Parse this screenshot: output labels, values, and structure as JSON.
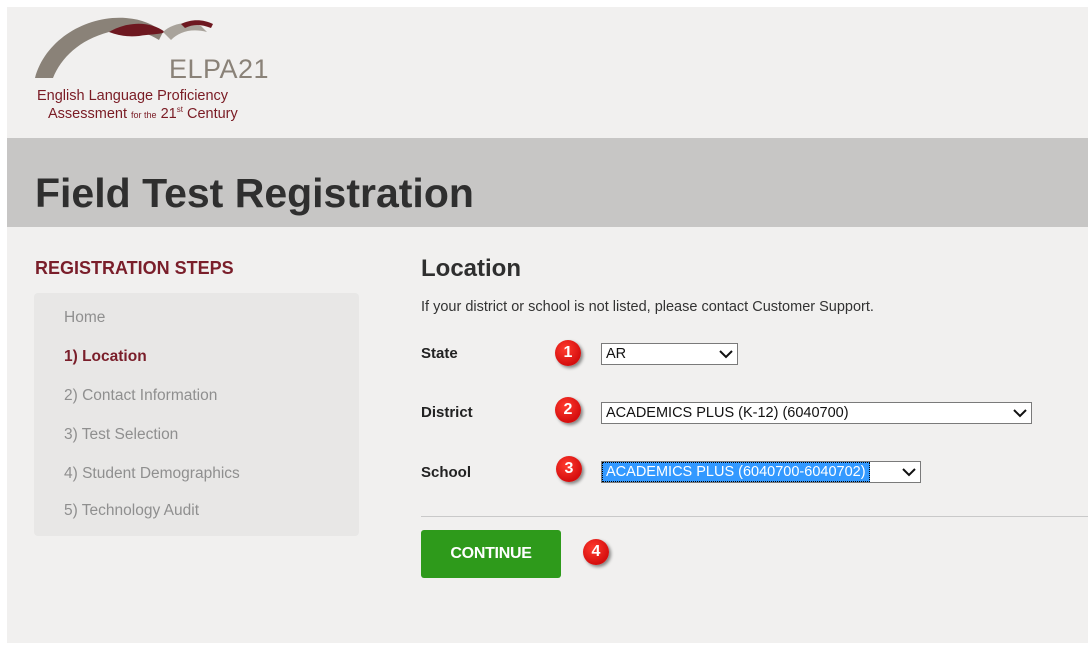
{
  "logo": {
    "name": "ELPA21",
    "line1": "English Language Proficiency",
    "line2_a": "Assessment",
    "line2_b": "for the",
    "line2_c": "21",
    "line2_sup": "st",
    "line2_d": "Century"
  },
  "page": {
    "title": "Field Test Registration"
  },
  "sidebar": {
    "heading": "REGISTRATION STEPS",
    "items": [
      {
        "label": "Home",
        "active": false
      },
      {
        "label": "1) Location",
        "active": true
      },
      {
        "label": "2) Contact Information",
        "active": false
      },
      {
        "label": "3) Test Selection",
        "active": false
      },
      {
        "label": "4) Student Demographics",
        "active": false
      },
      {
        "label": "5) Technology Audit",
        "active": false
      }
    ]
  },
  "main": {
    "heading": "Location",
    "help_text": "If your district or school is not listed, please contact Customer Support.",
    "fields": {
      "state": {
        "label": "State",
        "value": "AR",
        "badge": "1"
      },
      "district": {
        "label": "District",
        "value": "ACADEMICS PLUS (K-12) (6040700)",
        "badge": "2"
      },
      "school": {
        "label": "School",
        "value": "ACADEMICS PLUS (6040700-6040702)",
        "badge": "3"
      }
    },
    "continue_label": "CONTINUE",
    "continue_badge": "4"
  },
  "colors": {
    "brand_maroon": "#7a1e2a",
    "button_green": "#2e9a1b",
    "badge_red": "#d50e0e",
    "header_gray": "#c7c6c5",
    "selection_blue": "#3399ff"
  }
}
